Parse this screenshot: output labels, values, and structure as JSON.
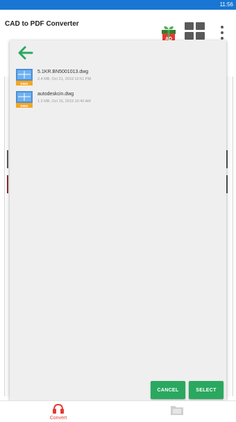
{
  "status_bar": {
    "time": "11:56"
  },
  "app_bar": {
    "title": "CAD to PDF Converter",
    "ad_badge": "AD"
  },
  "file_picker": {
    "files": [
      {
        "name": "5.1KR.BN5001013.dwg",
        "meta": "2.4 MB, Oct 21, 2019 12:51 PM"
      },
      {
        "name": "autodeskcin.dwg",
        "meta": "1.2 MB, Oct 16, 2019 10:40 AM"
      }
    ],
    "file_icon_label": "DWG",
    "cancel_label": "CANCEL",
    "select_label": "SELECT"
  },
  "bottom_nav": {
    "convert_label": "Convert"
  },
  "colors": {
    "status_bar": "#1976d2",
    "accent_green": "#2aa860",
    "active_red": "#e53935"
  }
}
